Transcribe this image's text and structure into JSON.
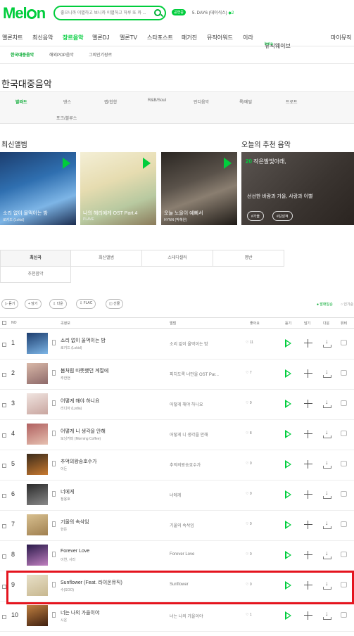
{
  "header": {
    "logo_text": "Melon",
    "search_placeholder": "좋으니까 이별하고 보니까 이별하고 하루 또 까 ...",
    "badge": "공연중",
    "live_text": "5. DAY6 (데이식스)",
    "live_marker": "◆2"
  },
  "gnb": [
    "멜론차트",
    "최신음악",
    "장르음악",
    "멜론DJ",
    "멜론TV",
    "스타포스트",
    "매거진",
    "뮤직어워드",
    "이라",
    "뮤직웨이브"
  ],
  "gnb_beta": "beta",
  "gnb_right": "마이뮤직",
  "lnb": [
    "한국대중음악",
    "해외POP음악",
    "그외인기장르"
  ],
  "page_title": "한국대중음악",
  "genres": [
    "발라드",
    "댄스",
    "랩/힙합",
    "R&B/Soul",
    "인디음악",
    "록/메탈",
    "트로트",
    "포크/블루스"
  ],
  "new_albums": {
    "heading": "최신앨범",
    "items": [
      {
        "title": "소리 없이 울먹이는 밤",
        "artist": "로키드 (Lokid)"
      },
      {
        "title": "나의 해리에게 OST Part.4",
        "artist": "PLAVE"
      },
      {
        "title": "오늘 노을이 예뻐서",
        "artist": "HYNN (박혜원)"
      }
    ]
  },
  "recommend": {
    "heading": "오늘의 추천 음악",
    "label_num": "20",
    "label_text": "작은발빛아래,",
    "subtitle": "선선한 바람과 가을, 사랑과 이별",
    "tags": [
      "#가을",
      "#감성적"
    ]
  },
  "tabs": [
    "최신곡",
    "최신앨범",
    "스테디셀러",
    "명반",
    "추천음악"
  ],
  "toolbar": [
    "▷ 듣기",
    "+ 담기",
    "⇩ 다운",
    "⇩ FLAC",
    "◫ 선물"
  ],
  "sort_options": [
    "● 발매일순",
    "○ 인기순"
  ],
  "columns": [
    "NO",
    "곡정보",
    "앨범",
    "좋아요",
    "듣기",
    "담기",
    "다운",
    "뮤비"
  ],
  "songs": [
    {
      "rank": "1",
      "title": "소리 없이 울먹이는 밤",
      "artist": "로키드 (Lokid)",
      "album": "소리 없이 울먹이는 밤",
      "likes": "♡ 11"
    },
    {
      "rank": "2",
      "title": "봄처럼 따뜻했던 계절에",
      "artist": "주한현",
      "album": "피치도록 너만을 OST Par...",
      "likes": "♡ 7"
    },
    {
      "rank": "3",
      "title": "어떻게 해야 하니요",
      "artist": "리디아 (Lydia)",
      "album": "어떻게 해야 하니요",
      "likes": "♡ 9"
    },
    {
      "rank": "4",
      "title": "어떻게 니 생각을 안해",
      "artist": "모닝커피 (Morning Coffee)",
      "album": "어떻게 니 생각을 안해",
      "likes": "♡ 8"
    },
    {
      "rank": "5",
      "title": "추억의왕송호수가",
      "artist": "이든",
      "album": "추억의왕송호수가",
      "likes": "♡ 0"
    },
    {
      "rank": "6",
      "title": "너에게",
      "artist": "정용호",
      "album": "너에게",
      "likes": "♡ 0"
    },
    {
      "rank": "7",
      "title": "기울의 속삭임",
      "artist": "한든",
      "album": "기울의 속삭임",
      "likes": "♡ 0"
    },
    {
      "rank": "8",
      "title": "Forever Love",
      "artist": "이연, 사라",
      "album": "Forever Love",
      "likes": "♡ 0"
    },
    {
      "rank": "9",
      "title": "Sunflower (Feat. 라이온뮤직)",
      "artist": "수(SOO)",
      "album": "Sunflower",
      "likes": "♡ 0"
    },
    {
      "rank": "10",
      "title": "너는 나의 가을이야",
      "artist": "시온",
      "album": "너는 나의 가을이야",
      "likes": "♡ 1"
    }
  ],
  "colors": {
    "accent": "#00cd3c",
    "highlight": "#e4141e"
  }
}
